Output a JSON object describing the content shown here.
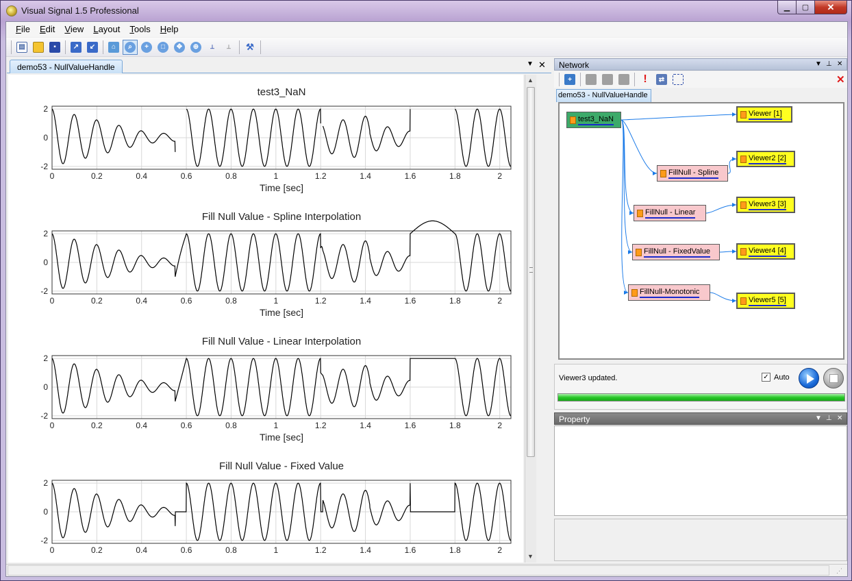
{
  "window": {
    "title": "Visual Signal 1.5 Professional"
  },
  "menu": [
    {
      "key": "F",
      "rest": "ile"
    },
    {
      "key": "E",
      "rest": "dit"
    },
    {
      "key": "V",
      "rest": "iew"
    },
    {
      "key": "L",
      "rest": "ayout"
    },
    {
      "key": "T",
      "rest": "ools"
    },
    {
      "key": "H",
      "rest": "elp"
    }
  ],
  "toolbar_icons": [
    "new-file-icon",
    "open-folder-icon",
    "save-icon",
    "export-icon",
    "import-icon",
    "home-icon",
    "zoom-icon",
    "zoom-in-icon",
    "zoom-fit-icon",
    "pan-icon",
    "zoom-point-icon",
    "axis-label-icon",
    "axis-format-icon",
    "tools-icon"
  ],
  "document": {
    "tab_label": "demo53 - NullValueHandle",
    "plots": [
      {
        "title": "test3_NaN",
        "xlabel": "Time [sec]",
        "mode": "nan"
      },
      {
        "title": "Fill Null Value - Spline Interpolation",
        "xlabel": "Time [sec]",
        "mode": "spline"
      },
      {
        "title": "Fill Null Value - Linear Interpolation",
        "xlabel": "Time [sec]",
        "mode": "linear"
      },
      {
        "title": "Fill Null Value - Fixed Value",
        "xlabel": "",
        "mode": "fixed"
      }
    ],
    "x_ticks": [
      "0",
      "0.2",
      "0.4",
      "0.6",
      "0.8",
      "1",
      "1.2",
      "1.4",
      "1.6",
      "1.8",
      "2"
    ],
    "y_ticks": [
      "2",
      "0",
      "-2"
    ],
    "xlim": [
      0,
      2.05
    ],
    "ylim": [
      -2.2,
      2.2
    ]
  },
  "network": {
    "header": "Network",
    "tab_label": "demo53 - NullValueHandle",
    "nodes": {
      "source": "test3_NaN",
      "spline": "FillNull - Spline",
      "linear": "FillNull - Linear",
      "fixed": "FillNull - FixedValue",
      "mono": "FillNull-Monotonic",
      "v1": "Viewer [1]",
      "v2": "Viewer2 [2]",
      "v3": "Viewer3 [3]",
      "v4": "Viewer4 [4]",
      "v5": "Viewer5 [5]"
    },
    "status": "Viewer3 updated.",
    "auto_label": "Auto",
    "auto_checked": "✓",
    "progress": 1.0
  },
  "property": {
    "header": "Property"
  },
  "colors": {
    "node_source": "#3daa6a",
    "node_filter": "#f8c8cc",
    "node_viewer": "#ffff20",
    "link": "#1a7ae8"
  }
}
